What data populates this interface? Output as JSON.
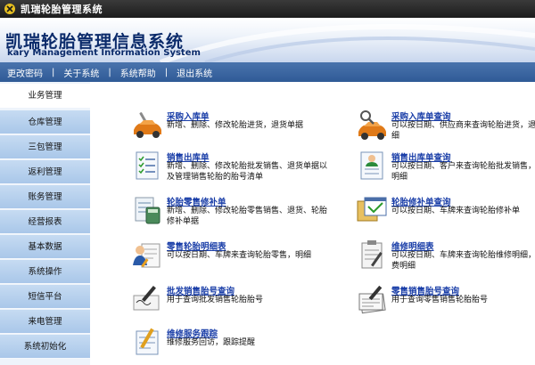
{
  "window": {
    "title": "凯瑞轮胎管理系统"
  },
  "banner": {
    "title_cn": "凯瑞轮胎管理信息系统",
    "title_en": "kary Management Information System"
  },
  "menu": [
    "更改密码",
    "关于系统",
    "系统帮助",
    "退出系统"
  ],
  "menu_separator": "|",
  "sidebar": {
    "items": [
      {
        "label": "业务管理",
        "active": true
      },
      {
        "label": "仓库管理",
        "active": false
      },
      {
        "label": "三包管理",
        "active": false
      },
      {
        "label": "返利管理",
        "active": false
      },
      {
        "label": "账务管理",
        "active": false
      },
      {
        "label": "经营报表",
        "active": false
      },
      {
        "label": "基本数据",
        "active": false
      },
      {
        "label": "系统操作",
        "active": false
      },
      {
        "label": "短信平台",
        "active": false
      },
      {
        "label": "来电管理",
        "active": false
      },
      {
        "label": "系统初始化",
        "active": false
      }
    ]
  },
  "cards": {
    "left": [
      {
        "title": "采购入库单",
        "desc": "新增、删除、修改轮胎进货，退货单据",
        "icon": "car-wrench-icon"
      },
      {
        "title": "销售出库单",
        "desc": "新增、删除、修改轮胎批发销售、退货单据以及管理销售轮胎的胎号清单",
        "icon": "checklist-icon"
      },
      {
        "title": "轮胎零售修补单",
        "desc": "新增、删除、修改轮胎零售销售、退货、轮胎修补单据",
        "icon": "document-calculator-icon"
      },
      {
        "title": "零售轮胎明细表",
        "desc": "可以按日期、车牌来查询轮胎零售，明细",
        "icon": "user-report-icon"
      },
      {
        "title": "批发销售胎号查询",
        "desc": "用于查询批发销售轮胎胎号",
        "icon": "pen-writing-icon"
      },
      {
        "title": "维修服务跟踪",
        "desc": "维修服务回访，跟踪提醒",
        "icon": "pencil-list-icon"
      }
    ],
    "right": [
      {
        "title": "采购入库单查询",
        "desc": "可以按日期、供应商来查询轮胎进货，退货明细",
        "icon": "car-search-icon"
      },
      {
        "title": "销售出库单查询",
        "desc": "可以按日期、客户来查询轮胎批发销售，退货明细",
        "icon": "doc-user-icon"
      },
      {
        "title": "轮胎修补单查询",
        "desc": "可以按日期、车牌来查询轮胎修补单",
        "icon": "folder-window-icon"
      },
      {
        "title": "维修明细表",
        "desc": "可以按日期、车牌来查询轮胎维修明细，修补费明细",
        "icon": "clipboard-pen-icon"
      },
      {
        "title": "零售销售胎号查询",
        "desc": "用于查询零售销售轮胎胎号",
        "icon": "stack-papers-icon"
      }
    ]
  }
}
